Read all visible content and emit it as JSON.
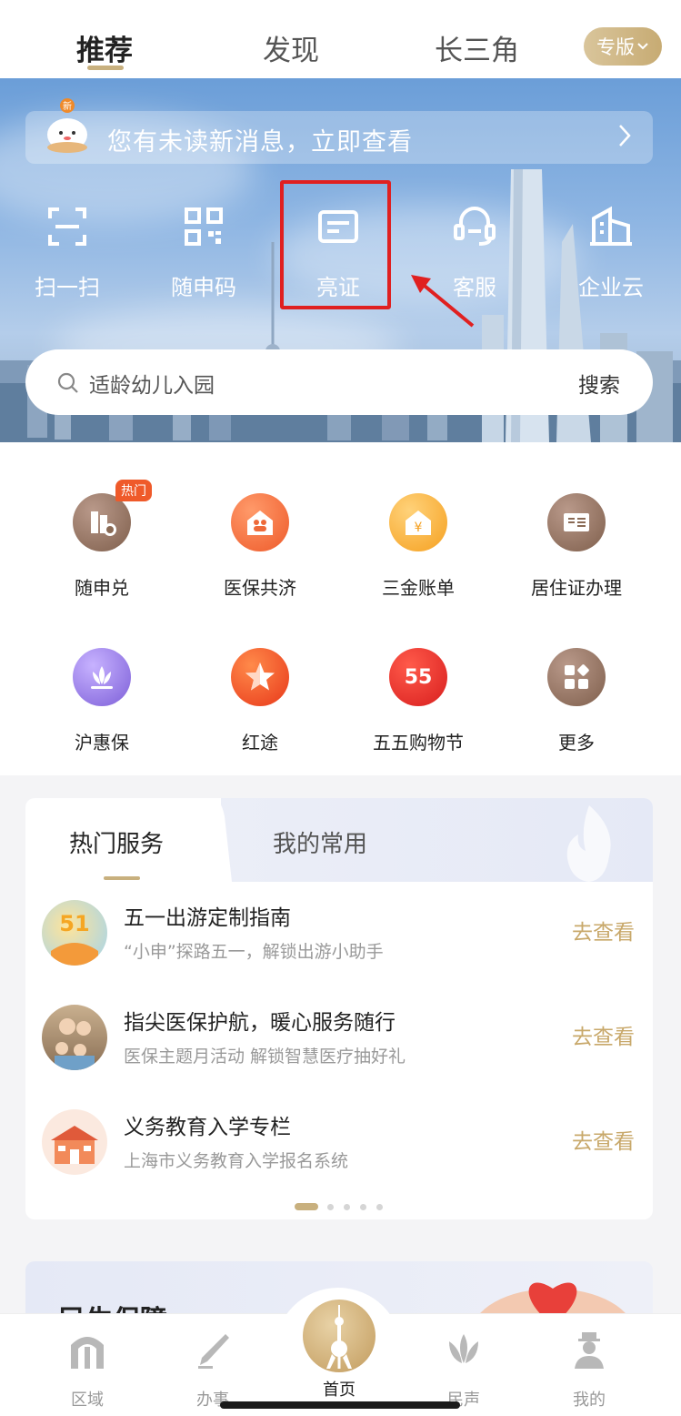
{
  "top_nav": {
    "tabs": [
      "推荐",
      "发现",
      "长三角"
    ],
    "edition_button": "专版"
  },
  "banner": {
    "notice_badge": "新",
    "notice_text": "您有未读新消息，立即查看",
    "quick_actions": [
      "扫一扫",
      "随申码",
      "亮证",
      "客服",
      "企业云"
    ],
    "search_placeholder": "适龄幼儿入园",
    "search_button": "搜索"
  },
  "services_grid": {
    "hot_tag": "热门",
    "items": [
      {
        "label": "随申兑",
        "icon": "building-voucher-icon",
        "color": "#8a6a55"
      },
      {
        "label": "医保共济",
        "icon": "house-family-icon",
        "color": "#f06a3c"
      },
      {
        "label": "三金账单",
        "icon": "house-yen-icon",
        "color": "#f5a623"
      },
      {
        "label": "居住证办理",
        "icon": "residence-card-icon",
        "color": "#8a6a55"
      },
      {
        "label": "沪惠保",
        "icon": "lotus-icon",
        "color": "#8d6fe0"
      },
      {
        "label": "红途",
        "icon": "red-star-icon",
        "color": "#ef4a1f"
      },
      {
        "label": "五五购物节",
        "icon": "shopping-festival-55-icon",
        "color": "#e23a2a"
      },
      {
        "label": "更多",
        "icon": "more-grid-icon",
        "color": "#8a6a55"
      }
    ]
  },
  "hot_services": {
    "tabs": [
      "热门服务",
      "我的常用"
    ],
    "items": [
      {
        "title": "五一出游定制指南",
        "subtitle": "“小申”探路五一，解锁出游小助手",
        "action": "去查看"
      },
      {
        "title": "指尖医保护航，暖心服务随行",
        "subtitle": "医保主题月活动 解锁智慧医疗抽好礼",
        "action": "去查看"
      },
      {
        "title": "义务教育入学专栏",
        "subtitle": "上海市义务教育入学报名系统",
        "action": "去查看"
      }
    ],
    "page_count": 5,
    "active_page": 1
  },
  "promo": {
    "title": "民生保障"
  },
  "tab_bar": {
    "items": [
      "区域",
      "办事",
      "首页",
      "民声",
      "我的"
    ],
    "active": "首页"
  },
  "colors": {
    "accent_gold": "#c8a86a",
    "highlight_red": "#e02020",
    "hot_orange": "#ef5a2a"
  }
}
